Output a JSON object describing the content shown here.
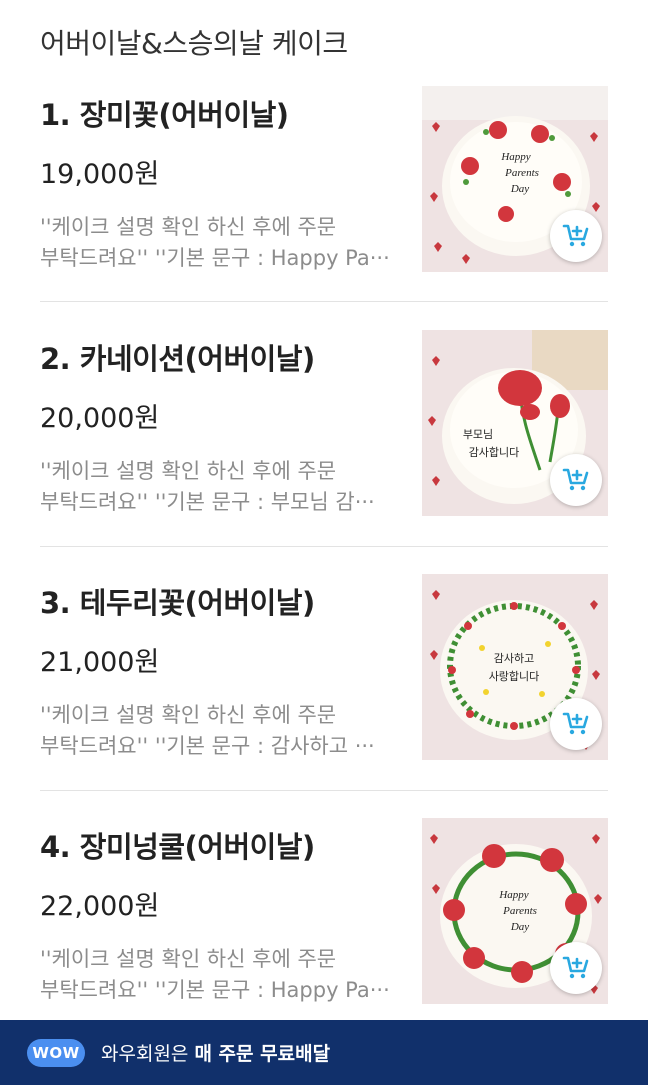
{
  "section": {
    "title": "어버이날&스승의날 케이크"
  },
  "products": [
    {
      "name": "1. 장미꽃(어버이날)",
      "price": "19,000원",
      "desc_line1": "''케이크 설명 확인 하신 후에 주문",
      "desc_line2": "부탁드려요'' ''기본 문구 : Happy Pa···",
      "cake_text": [
        "Happy",
        "Parents",
        "Day"
      ]
    },
    {
      "name": "2. 카네이션(어버이날)",
      "price": "20,000원",
      "desc_line1": "''케이크 설명 확인 하신 후에 주문",
      "desc_line2": "부탁드려요'' ''기본 문구 : 부모님 감···",
      "cake_text": [
        "부모님",
        "감사합니다"
      ]
    },
    {
      "name": "3. 테두리꽃(어버이날)",
      "price": "21,000원",
      "desc_line1": "''케이크 설명 확인 하신 후에 주문",
      "desc_line2": "부탁드려요'' ''기본 문구 : 감사하고 ···",
      "cake_text": [
        "감사하고",
        "사랑합니다"
      ]
    },
    {
      "name": "4. 장미넝쿨(어버이날)",
      "price": "22,000원",
      "desc_line1": "''케이크 설명 확인 하신 후에 주문",
      "desc_line2": "부탁드려요'' ''기본 문구 : Happy Pa···",
      "cake_text": [
        "Happy",
        "Parents",
        "Day"
      ]
    }
  ],
  "banner": {
    "badge": "WOW",
    "text_prefix": "와우회원은 ",
    "text_strong": "매 주문 무료배달"
  },
  "colors": {
    "banner_bg": "#11306b",
    "badge_bg": "#4b8ff0",
    "cart_icon": "#29a8e0"
  }
}
